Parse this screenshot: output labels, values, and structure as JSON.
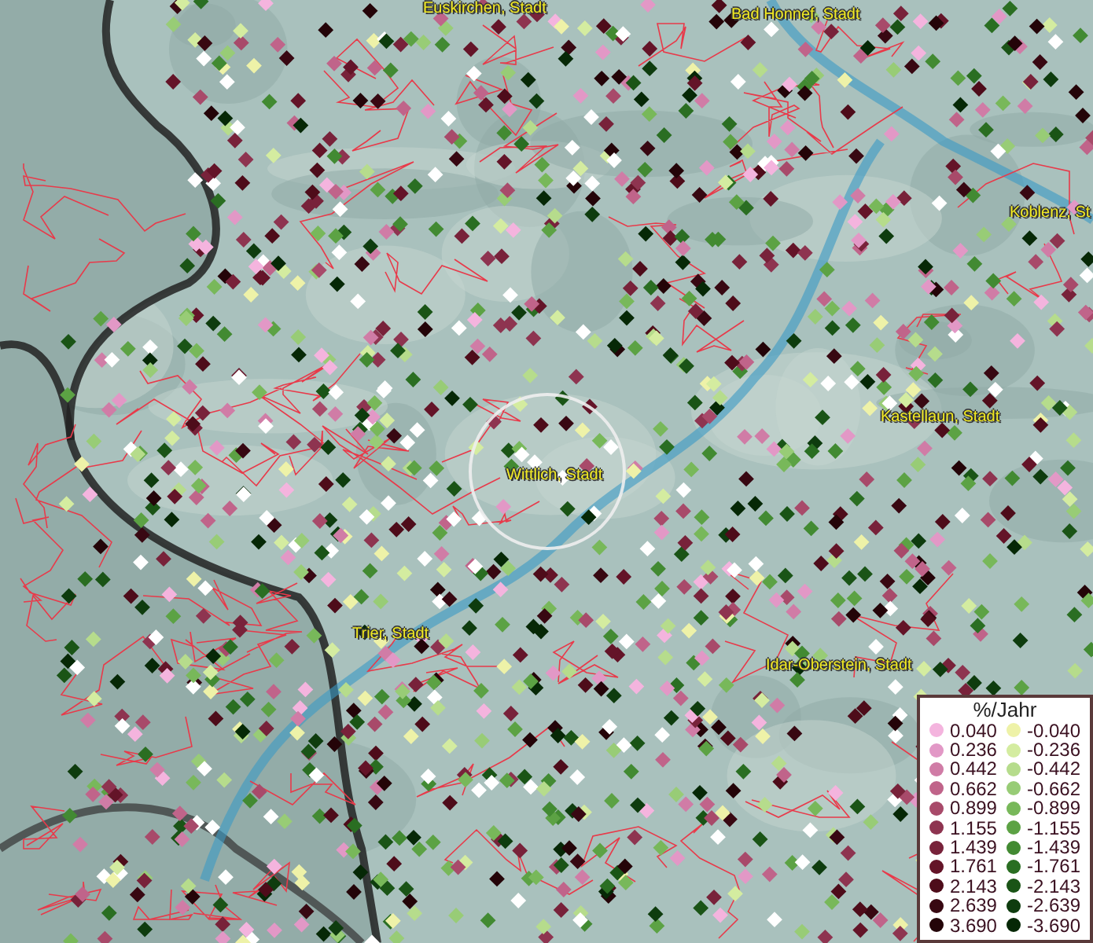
{
  "map": {
    "places": [
      {
        "label": "Euskirchen, Stadt"
      },
      {
        "label": "Bad Honnef, Stadt"
      },
      {
        "label": "Koblenz, St"
      },
      {
        "label": "Kastellaun, Stadt"
      },
      {
        "label": "Wittlich, Stadt"
      },
      {
        "label": "Trier, Stadt"
      },
      {
        "label": "Idar-Oberstein, Stadt"
      }
    ]
  },
  "legend": {
    "title": "%/Jahr",
    "classes": [
      {
        "value": "0.040",
        "color": "#f4b4de"
      },
      {
        "value": "-0.040",
        "color": "#eef2a8"
      },
      {
        "value": "0.236",
        "color": "#e298c6"
      },
      {
        "value": "-0.236",
        "color": "#d4eca0"
      },
      {
        "value": "0.442",
        "color": "#d07ca6"
      },
      {
        "value": "-0.442",
        "color": "#b6dc8c"
      },
      {
        "value": "0.662",
        "color": "#c0648a"
      },
      {
        "value": "-0.662",
        "color": "#98cc76"
      },
      {
        "value": "0.899",
        "color": "#a84a6a"
      },
      {
        "value": "-0.899",
        "color": "#78b85a"
      },
      {
        "value": "1.155",
        "color": "#8e3450"
      },
      {
        "value": "-1.155",
        "color": "#5ca244"
      },
      {
        "value": "1.439",
        "color": "#78223a"
      },
      {
        "value": "-1.439",
        "color": "#428a32"
      },
      {
        "value": "1.761",
        "color": "#641428"
      },
      {
        "value": "-1.761",
        "color": "#2a6e22"
      },
      {
        "value": "2.143",
        "color": "#4e0c1a"
      },
      {
        "value": "-2.143",
        "color": "#1a5416"
      },
      {
        "value": "2.639",
        "color": "#380812"
      },
      {
        "value": "-2.639",
        "color": "#0e3c0e"
      },
      {
        "value": "3.690",
        "color": "#240408"
      },
      {
        "value": "-3.690",
        "color": "#062806"
      }
    ]
  }
}
